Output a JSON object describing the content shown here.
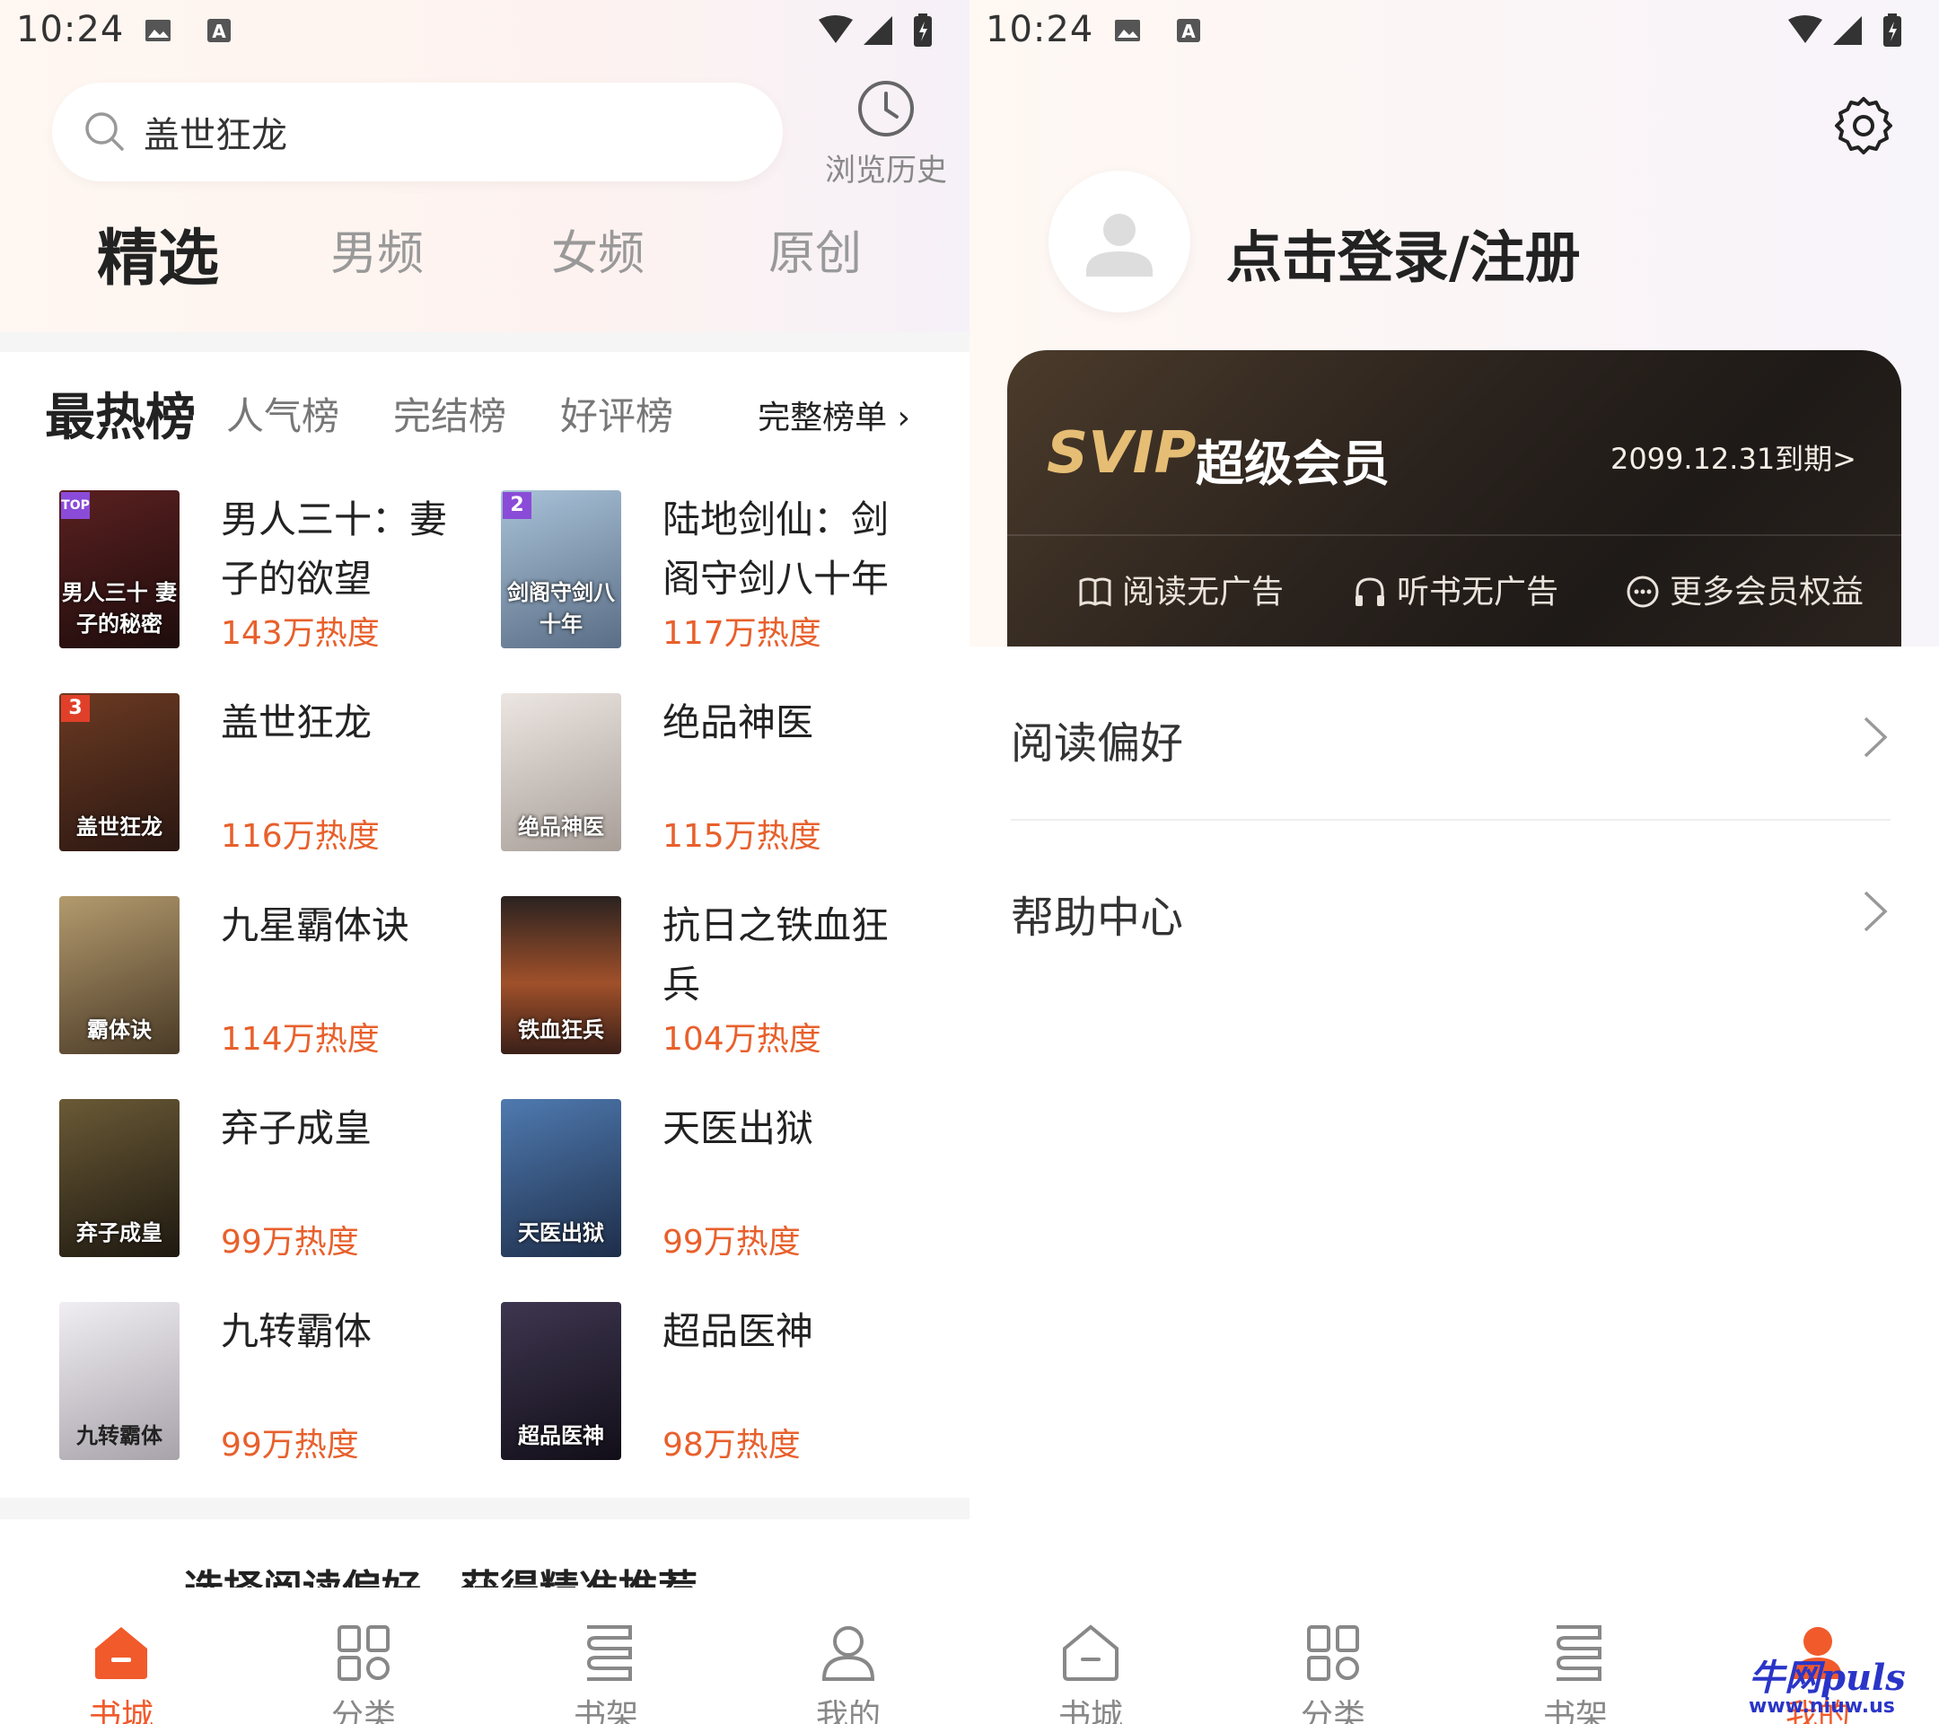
{
  "left": {
    "status": {
      "time": "10:24"
    },
    "search": {
      "query": "盖世狂龙",
      "history_label": "浏览历史"
    },
    "top_tabs": [
      "精选",
      "男频",
      "女频",
      "原创"
    ],
    "rank_tabs": [
      "最热榜",
      "人气榜",
      "完结榜",
      "好评榜"
    ],
    "full_rank_label": "完整榜单 ›",
    "books": [
      {
        "rank": "TOP",
        "title": "男人三十：妻子的欲望",
        "heat": "143万热度",
        "cover_text": "男人三十 妻子的秘密",
        "cover_color": "#3a1616"
      },
      {
        "rank": "2",
        "title": "陆地剑仙：剑阁守剑八十年",
        "heat": "117万热度",
        "cover_text": "剑阁守剑八十年",
        "cover_color": "#7d9ab6"
      },
      {
        "rank": "3",
        "title": "盖世狂龙",
        "heat": "116万热度",
        "cover_text": "盖世狂龙",
        "cover_color": "#4a2a1e"
      },
      {
        "rank": "",
        "title": "绝品神医",
        "heat": "115万热度",
        "cover_text": "绝品神医",
        "cover_color": "#c9c2bd"
      },
      {
        "rank": "",
        "title": "九星霸体诀",
        "heat": "114万热度",
        "cover_text": "霸体诀",
        "cover_color": "#6e5a3a"
      },
      {
        "rank": "",
        "title": "抗日之铁血狂兵",
        "heat": "104万热度",
        "cover_text": "铁血狂兵",
        "cover_color": "#5a3322"
      },
      {
        "rank": "",
        "title": "弃子成皇",
        "heat": "99万热度",
        "cover_text": "弃子成皇",
        "cover_color": "#4a3a22"
      },
      {
        "rank": "",
        "title": "天医出狱",
        "heat": "99万热度",
        "cover_text": "天医出狱",
        "cover_color": "#3a5a86"
      },
      {
        "rank": "",
        "title": "九转霸体",
        "heat": "99万热度",
        "cover_text": "九转霸体",
        "cover_color": "#cfcbd0"
      },
      {
        "rank": "",
        "title": "超品医神",
        "heat": "98万热度",
        "cover_text": "超品医神",
        "cover_color": "#2a2530"
      }
    ],
    "peek_text": "选择阅读偏好，获得精准推荐",
    "nav": [
      "书城",
      "分类",
      "书架",
      "我的"
    ]
  },
  "right": {
    "status": {
      "time": "10:24"
    },
    "login_label": "点击登录/注册",
    "svip": {
      "logo": "SVIP",
      "title": "超级会员",
      "expire": "2099.12.31到期>"
    },
    "perks": [
      "阅读无广告",
      "听书无广告",
      "更多会员权益"
    ],
    "menu": [
      "阅读偏好",
      "帮助中心"
    ],
    "nav": [
      "书城",
      "分类",
      "书架",
      "我的"
    ],
    "watermark": {
      "top": "牛网puls",
      "bottom": "www.niuw.us"
    }
  },
  "colors": {
    "accent": "#f15a2b",
    "heat": "#e8602c"
  }
}
